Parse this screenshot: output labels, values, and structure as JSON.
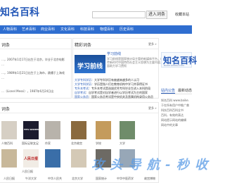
{
  "header": {
    "logo_text": "知名百科",
    "search_placeholder": "",
    "search_button": "进入词条",
    "favorite": "收藏本站"
  },
  "nav": {
    "items": [
      "人物百科",
      "艺术百科",
      "商业百科",
      "文化百科",
      "科技百科",
      "物理百科",
      "历史百科"
    ]
  },
  "left_panel": {
    "title": "词条",
    "lines": [
      "…，2007年1月17日出生于北京，毕业于北京电影",
      "…",
      "…，1989年1月21日出生于上海市，跳槽于上海戏",
      "…",
      "…（Lionel Messi），1987年6月24日出"
    ]
  },
  "center_panel": {
    "title": "精彩词条",
    "more": "更多 »",
    "feature": {
      "image_text": "学习前线",
      "title": "学习前线",
      "desc": "学习前线是国家统计局主管的新媒体平台，以宣传新时代中国特色社会主义思想为主要内容，全面助力学习贯彻"
    },
    "links": [
      {
        "hl": "大学专科学历",
        "text": "：大学专科学历有被越来越多的人认可"
      },
      {
        "hl": "大学专科学历",
        "text": "：学历是指人们在教育机构中学习并获得证书"
      },
      {
        "hl": "专升本考试",
        "text": "：专升本考试是选拔优秀专科毕业生进入本科阶段"
      },
      {
        "hl": "自学考试",
        "text": "：自学考试是对自学者进行以学历考试为主的国家"
      },
      {
        "hl": "国家公务员",
        "text": "：国家公务员考试是中央机关及直属机构录用公务员"
      }
    ]
  },
  "right_panel": {
    "logo_text": "知名百科",
    "logo_sub": "BAIKE.GHINGI.COM",
    "tabs": [
      "站内公告",
      "最新动态"
    ],
    "lines": [
      "知名百科 www.baike.",
      "于在所有用户中推广普",
      "科技百科百科全书",
      "百科，有效的表达",
      "网站提示网站的编辑",
      "网站中的文章"
    ]
  },
  "bottom_panel": {
    "title": "词条",
    "more": "更多 »",
    "thumbs": [
      {
        "caption": "人物百科",
        "label": ""
      },
      {
        "caption": "国际足联女足",
        "label": "FIFA WOMEN'S"
      },
      {
        "caption": "作家",
        "label": ""
      },
      {
        "caption": "北京故宫",
        "label": ""
      },
      {
        "caption": "学校",
        "label": ""
      },
      {
        "caption": "大学",
        "label": ""
      },
      {
        "caption": "人民日报",
        "label": "人民日报"
      },
      {
        "caption": "中国传媒",
        "label": ""
      },
      {
        "caption": "",
        "label": ""
      },
      {
        "caption": "电影",
        "label": ""
      },
      {
        "caption": "中国科学院",
        "label": ""
      },
      {
        "caption": "",
        "label": ""
      }
    ]
  },
  "bottom_links": [
    "人民日报",
    "午洋大学",
    "中华人民共",
    "北京大学",
    "国家统计",
    "中华中医药学",
    "故宫博物"
  ],
  "watermark": "攻 头 导 航 - 秒 收",
  "colors": {
    "brand": "#2458b8",
    "nav": "#2f6ed0"
  }
}
